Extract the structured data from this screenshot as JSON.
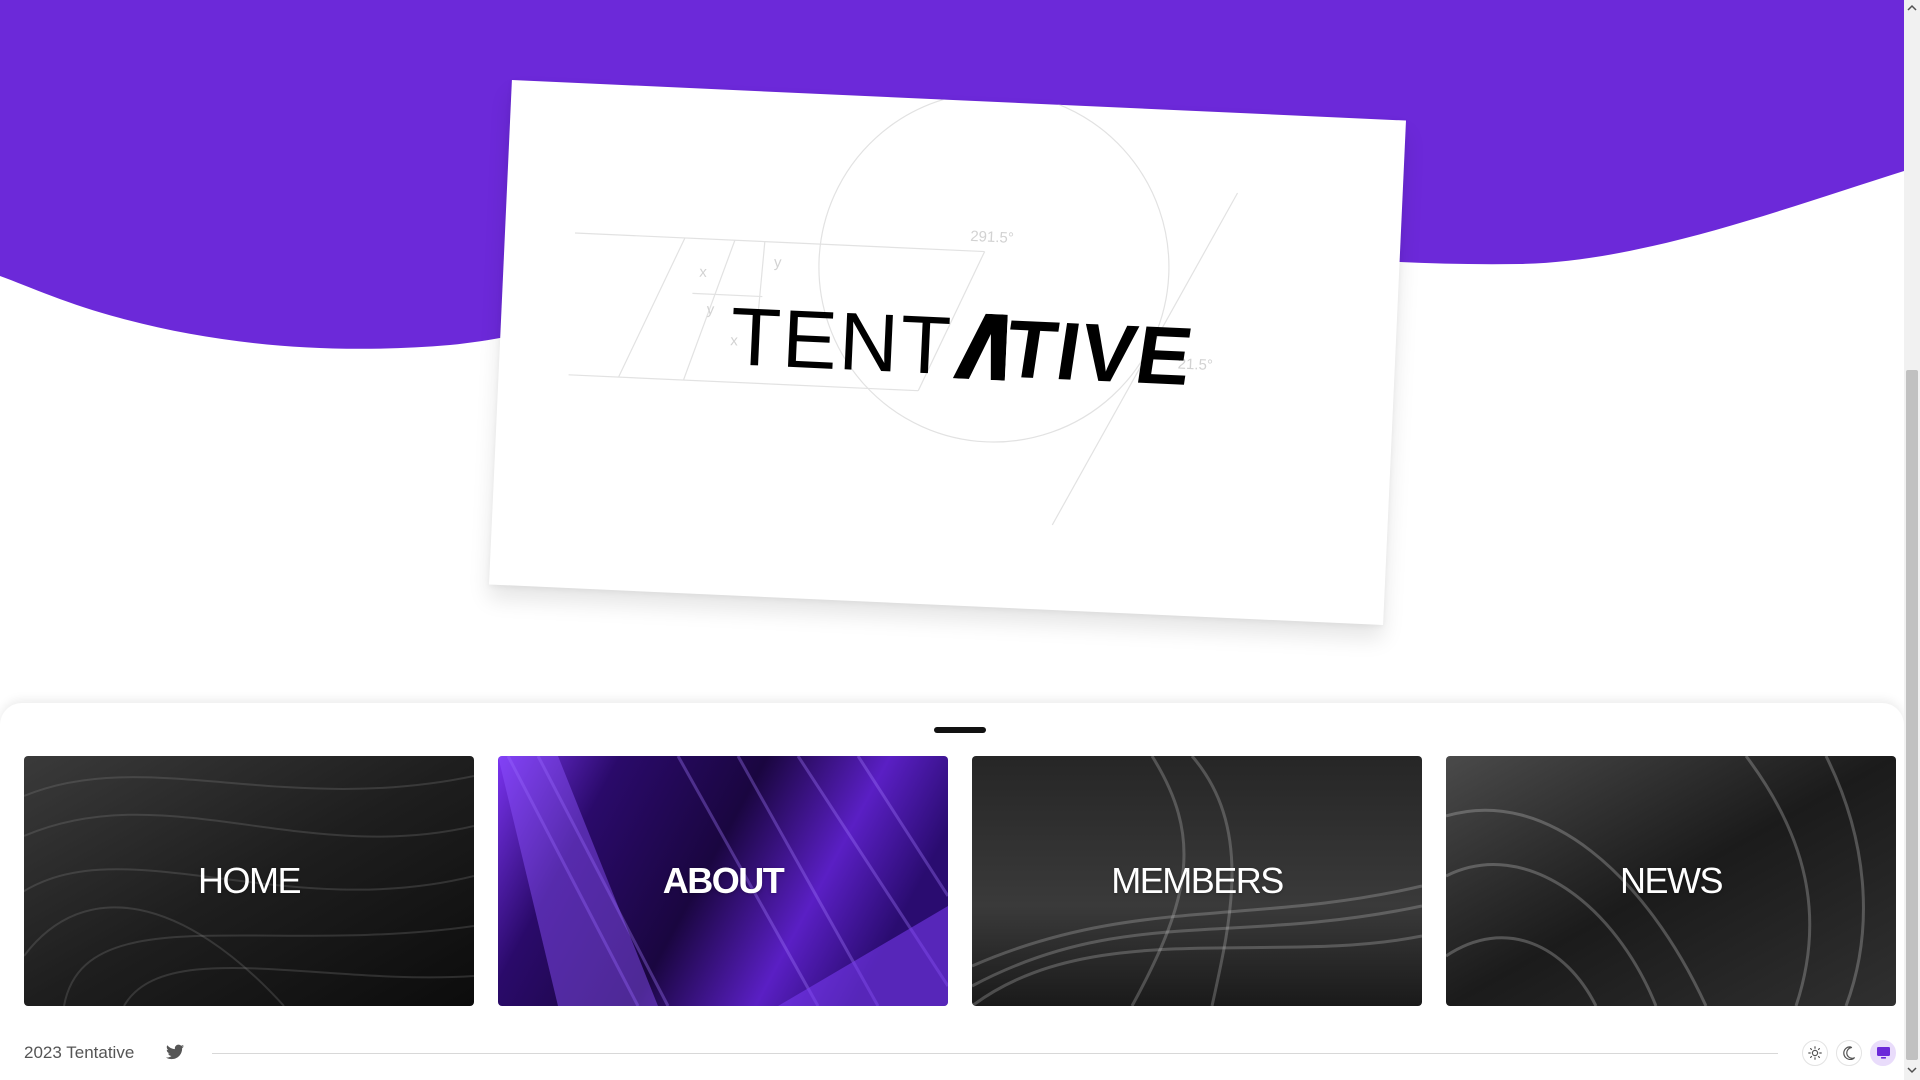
{
  "brand": {
    "wordmark_light": "TENT",
    "wordmark_bold": "TIVE",
    "accent_color": "#6c29d9"
  },
  "construction": {
    "angle_top": "291.5°",
    "angle_right": "21.5°",
    "mark_x": "x",
    "mark_y": "y"
  },
  "nav": {
    "tiles": [
      {
        "label": "HOME",
        "active": false
      },
      {
        "label": "ABOUT",
        "active": true
      },
      {
        "label": "MEMBERS",
        "active": false
      },
      {
        "label": "NEWS",
        "active": false
      }
    ]
  },
  "footer": {
    "copyright": "2023 Tentative",
    "social_icon": "twitter-icon",
    "theme_options": [
      "sun-icon",
      "moon-icon",
      "monitor-icon"
    ],
    "selected_theme": "monitor-icon"
  }
}
